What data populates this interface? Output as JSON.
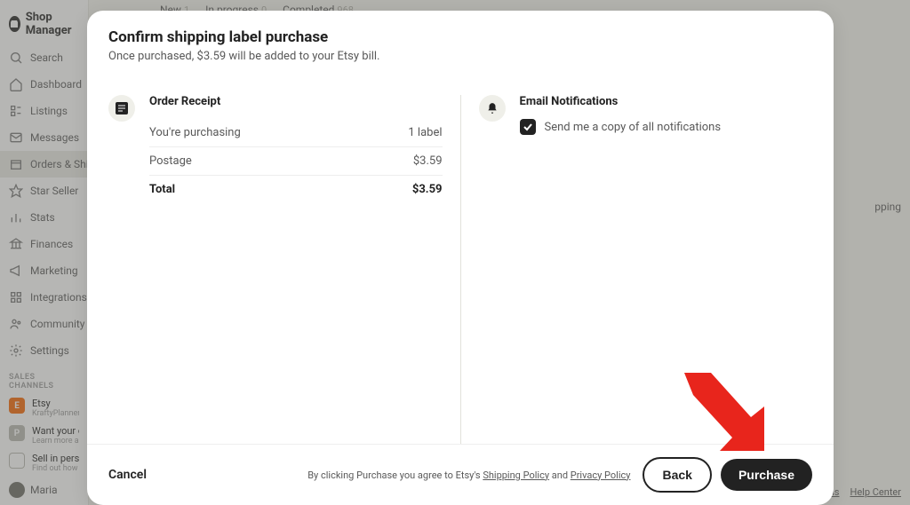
{
  "brand": "Shop Manager",
  "sidebar": {
    "items": [
      {
        "label": "Search"
      },
      {
        "label": "Dashboard"
      },
      {
        "label": "Listings"
      },
      {
        "label": "Messages"
      },
      {
        "label": "Orders & Shipping"
      },
      {
        "label": "Star Seller"
      },
      {
        "label": "Stats"
      },
      {
        "label": "Finances"
      },
      {
        "label": "Marketing"
      },
      {
        "label": "Integrations"
      },
      {
        "label": "Community & Help"
      },
      {
        "label": "Settings"
      }
    ],
    "section": "SALES CHANNELS",
    "channels": [
      {
        "badge": "E",
        "name": "Etsy",
        "sub": "KraftyPlanner"
      },
      {
        "badge": "P",
        "name": "Want your own website?",
        "sub": "Learn more about Pattern"
      },
      {
        "badge": "□",
        "name": "Sell in person",
        "sub": "Find out how with Square"
      }
    ],
    "user": "Maria"
  },
  "bg_tabs": {
    "new": {
      "label": "New",
      "count": "1"
    },
    "in_progress": {
      "label": "In progress",
      "count": "0"
    },
    "completed": {
      "label": "Completed",
      "count": "968"
    }
  },
  "bg_right": "pping",
  "bg_footer": {
    "a": "ns",
    "b": "Help Center"
  },
  "modal": {
    "title": "Confirm shipping label purchase",
    "subtitle": "Once purchased, $3.59 will be added to your Etsy bill.",
    "receipt": {
      "heading": "Order Receipt",
      "rows": [
        {
          "label": "You're purchasing",
          "value": "1 label"
        },
        {
          "label": "Postage",
          "value": "$3.59"
        }
      ],
      "total": {
        "label": "Total",
        "value": "$3.59"
      }
    },
    "notifications": {
      "heading": "Email Notifications",
      "checkbox_label": "Send me a copy of all notifications",
      "checked": true
    },
    "footer": {
      "cancel": "Cancel",
      "disclaimer_pre": "By clicking Purchase you agree to Etsy's ",
      "link1": "Shipping Policy",
      "mid": " and ",
      "link2": "Privacy Policy",
      "back": "Back",
      "purchase": "Purchase"
    }
  }
}
